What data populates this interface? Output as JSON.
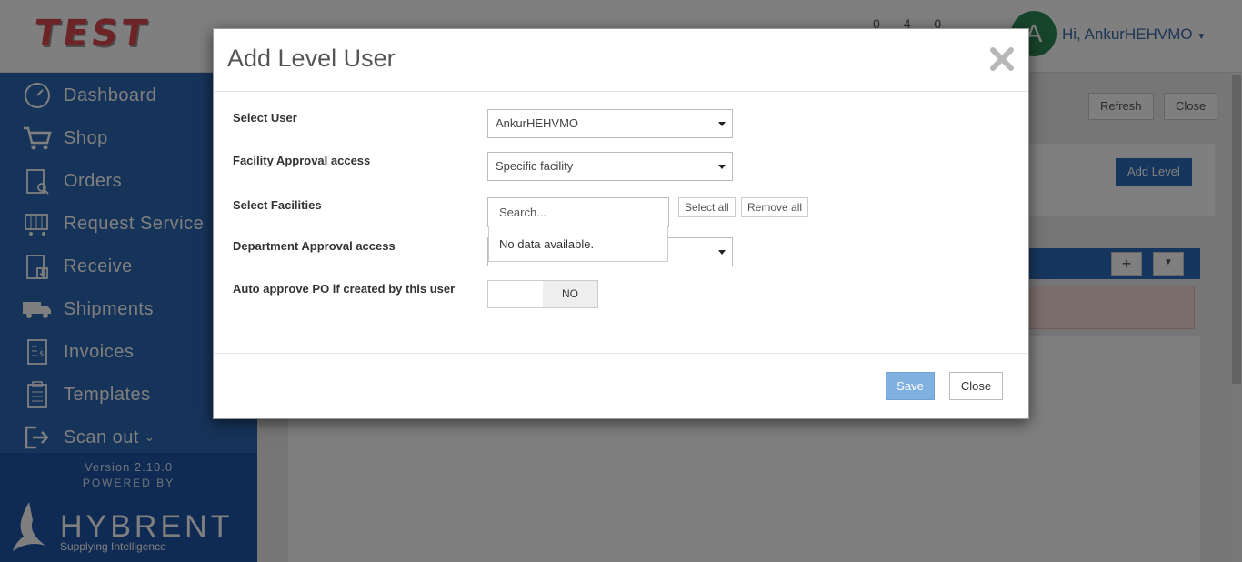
{
  "app": {
    "logo_text": "TEST",
    "greeting": "Hi, AnkurHEHVMO",
    "avatar_initial": "A",
    "counters": [
      "0",
      "4",
      "0"
    ]
  },
  "sidebar": {
    "items": [
      {
        "label": "Dashboard",
        "icon": "dashboard-gauge-icon"
      },
      {
        "label": "Shop",
        "icon": "cart-icon"
      },
      {
        "label": "Orders",
        "icon": "clipboard-search-icon"
      },
      {
        "label": "Request Service",
        "icon": "service-cart-icon"
      },
      {
        "label": "Receive",
        "icon": "clipboard-download-icon"
      },
      {
        "label": "Shipments",
        "icon": "truck-icon"
      },
      {
        "label": "Invoices",
        "icon": "invoice-icon"
      },
      {
        "label": "Templates",
        "icon": "template-clipboard-icon"
      },
      {
        "label": "Scan out",
        "icon": "scan-out-icon"
      }
    ],
    "version": "Version 2.10.0",
    "powered_by": "POWERED BY",
    "brand": "HYBRENT",
    "brand_tagline": "Supplying Intelligence"
  },
  "background": {
    "refresh_label": "Refresh",
    "close_label": "Close",
    "add_level_label": "Add Level",
    "plus_label": "+"
  },
  "modal": {
    "title": "Add Level User",
    "fields": {
      "select_user": {
        "label": "Select User",
        "value": "AnkurHEHVMO"
      },
      "facility_access": {
        "label": "Facility Approval access",
        "value": "Specific facility"
      },
      "select_facilities": {
        "label": "Select Facilities",
        "search_placeholder": "Search...",
        "select_all": "Select all",
        "remove_all": "Remove all",
        "empty_message": "No data available."
      },
      "department_access": {
        "label": "Department Approval access",
        "value": ""
      },
      "auto_approve": {
        "label": "Auto approve PO if created by this user",
        "state": "NO"
      }
    },
    "save_label": "Save",
    "close_label": "Close"
  },
  "colors": {
    "sidebar": "#2d66b3",
    "save_button": "#7fb0e0",
    "accent_link": "#3b6aa8"
  }
}
